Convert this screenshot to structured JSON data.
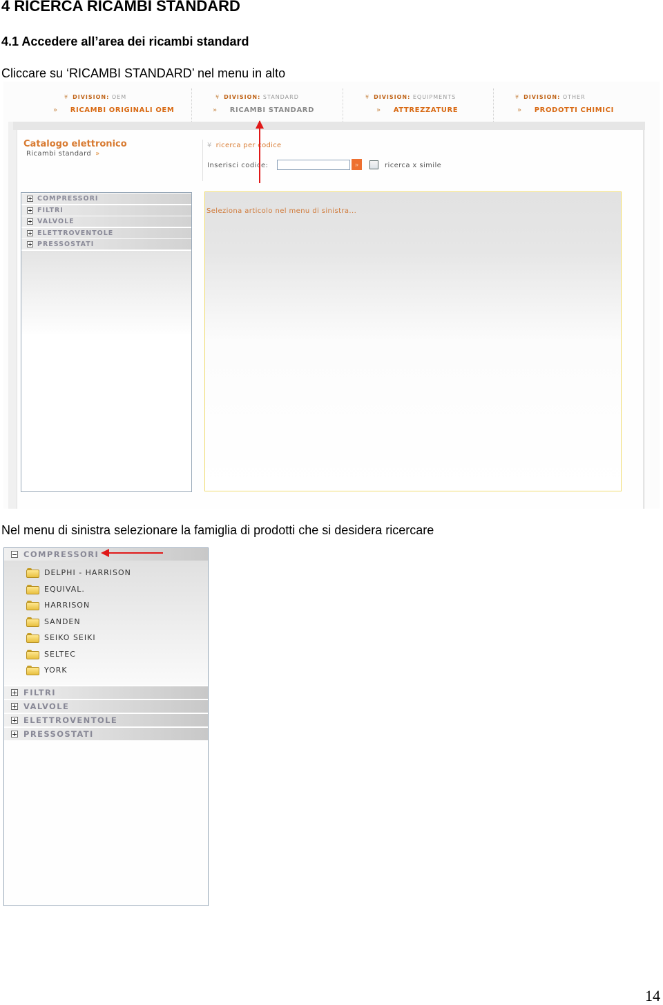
{
  "document": {
    "heading": "4 RICERCA RICAMBI STANDARD",
    "subheading": "4.1 Accedere all’area dei ricambi standard",
    "instruction_1": "Cliccare su ‘RICAMBI STANDARD’ nel menu in alto",
    "instruction_2": "Nel menu di sinistra selezionare la famiglia di prodotti che si desidera ricercare",
    "page_number": "14"
  },
  "top_nav": {
    "division_label": "DIVISION:",
    "chevron": "»",
    "down_chevron": "¥",
    "items": [
      {
        "division": "OEM",
        "label": "RICAMBI ORIGINALI OEM",
        "active": false
      },
      {
        "division": "STANDARD",
        "label": "RICAMBI STANDARD",
        "active": true
      },
      {
        "division": "EQUIPMENTS",
        "label": "ATTREZZATURE",
        "active": false
      },
      {
        "division": "OTHER",
        "label": "PRODOTTI CHIMICI",
        "active": false
      }
    ]
  },
  "catalog": {
    "title": "Catalogo elettronico",
    "subtitle": "Ricambi standard",
    "subtitle_chevron": "»"
  },
  "search": {
    "title": "ricerca per codice",
    "title_chevron": "¥",
    "code_label": "Inserisci codice:",
    "code_value": "",
    "go_button": "»",
    "similar_checkbox_label": "ricerca x simile",
    "similar_checked": false
  },
  "left_menu": {
    "items": [
      {
        "label": "COMPRESSORI",
        "expanded": false
      },
      {
        "label": "FILTRI",
        "expanded": false
      },
      {
        "label": "VALVOLE",
        "expanded": false
      },
      {
        "label": "ELETTROVENTOLE",
        "expanded": false
      },
      {
        "label": "PRESSOSTATI",
        "expanded": false
      }
    ]
  },
  "content": {
    "message": "Seleziona articolo nel menu di sinistra..."
  },
  "expanded_menu": {
    "open_category": "COMPRESSORI",
    "subitems": [
      "DELPHI - HARRISON",
      "EQUIVAL.",
      "HARRISON",
      "SANDEN",
      "SEIKO SEIKI",
      "SELTEC",
      "YORK"
    ],
    "other_categories": [
      "FILTRI",
      "VALVOLE",
      "ELETTROVENTOLE",
      "PRESSOSTATI"
    ]
  },
  "colors": {
    "accent_orange": "#d86a14",
    "annotation_red": "#e01818",
    "menu_text_gray": "#8a8a98",
    "content_border": "#f0dc70"
  }
}
